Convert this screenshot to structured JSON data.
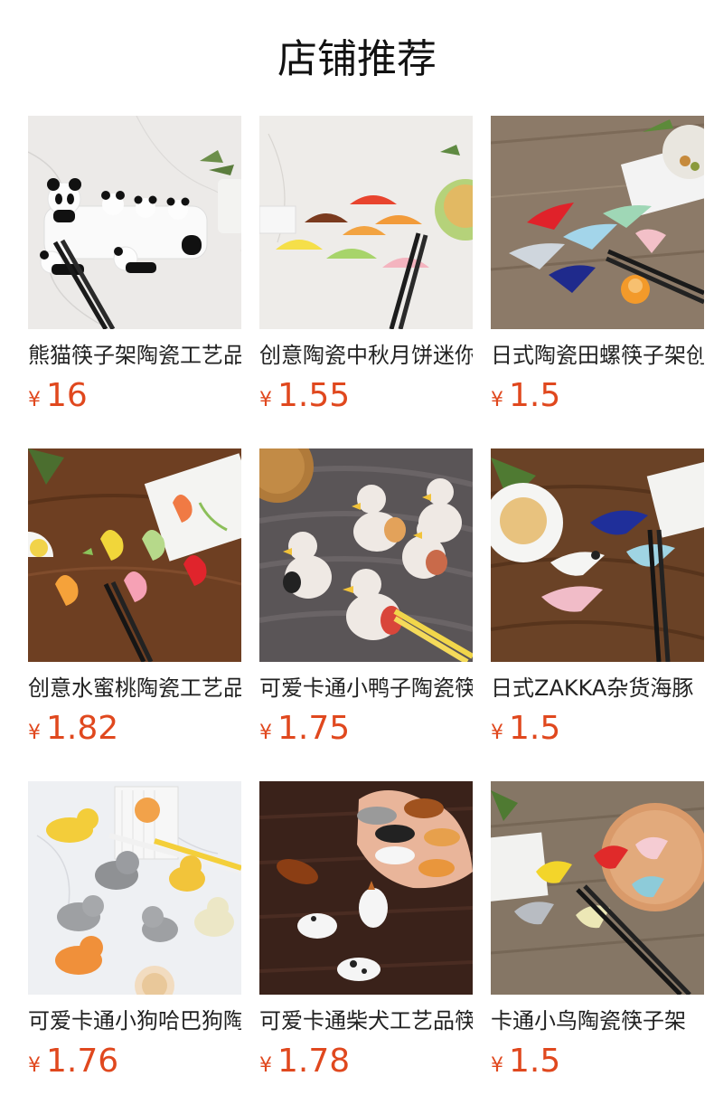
{
  "page": {
    "title": "店铺推荐"
  },
  "currency_symbol": "¥",
  "products": [
    {
      "name": "熊猫筷子架陶瓷工艺品",
      "price": "16",
      "scene": "panda-chopstick-rest-icon"
    },
    {
      "name": "创意陶瓷中秋月饼迷你",
      "price": "1.55",
      "scene": "mooncake-chopstick-rest-icon"
    },
    {
      "name": "日式陶瓷田螺筷子架创",
      "price": "1.5",
      "scene": "conch-chopstick-rest-icon"
    },
    {
      "name": "创意水蜜桃陶瓷工艺品",
      "price": "1.82",
      "scene": "peach-chopstick-rest-icon"
    },
    {
      "name": "可爱卡通小鸭子陶瓷筷",
      "price": "1.75",
      "scene": "duck-chopstick-rest-icon"
    },
    {
      "name": "日式ZAKKA杂货海豚",
      "price": "1.5",
      "scene": "dolphin-chopstick-rest-icon"
    },
    {
      "name": "可爱卡通小狗哈巴狗陶",
      "price": "1.76",
      "scene": "puppy-chopstick-rest-icon"
    },
    {
      "name": "可爱卡通柴犬工艺品筷",
      "price": "1.78",
      "scene": "shiba-chopstick-rest-icon"
    },
    {
      "name": "卡通小鸟陶瓷筷子架",
      "price": "1.5",
      "scene": "bird-chopstick-rest-icon"
    }
  ],
  "colors": {
    "price": "#e0481e",
    "title": "#111111",
    "name": "#222222"
  }
}
